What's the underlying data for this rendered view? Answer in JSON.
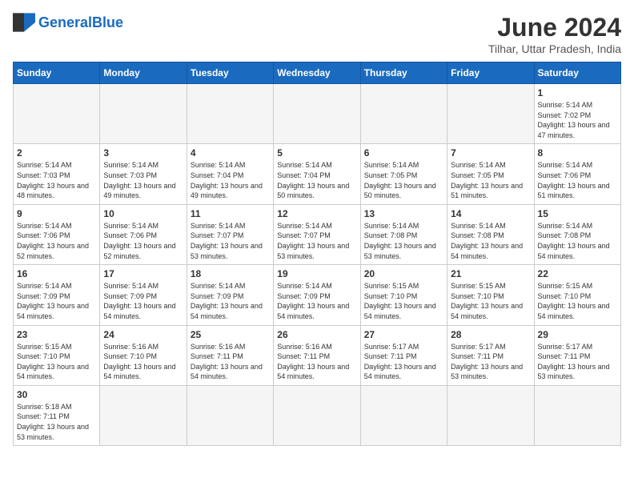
{
  "header": {
    "logo_general": "General",
    "logo_blue": "Blue",
    "month_title": "June 2024",
    "subtitle": "Tilhar, Uttar Pradesh, India"
  },
  "weekdays": [
    "Sunday",
    "Monday",
    "Tuesday",
    "Wednesday",
    "Thursday",
    "Friday",
    "Saturday"
  ],
  "days": [
    {
      "num": "",
      "info": ""
    },
    {
      "num": "",
      "info": ""
    },
    {
      "num": "",
      "info": ""
    },
    {
      "num": "",
      "info": ""
    },
    {
      "num": "",
      "info": ""
    },
    {
      "num": "",
      "info": ""
    },
    {
      "num": "1",
      "info": "Sunrise: 5:14 AM\nSunset: 7:02 PM\nDaylight: 13 hours and 47 minutes."
    },
    {
      "num": "2",
      "info": "Sunrise: 5:14 AM\nSunset: 7:03 PM\nDaylight: 13 hours and 48 minutes."
    },
    {
      "num": "3",
      "info": "Sunrise: 5:14 AM\nSunset: 7:03 PM\nDaylight: 13 hours and 49 minutes."
    },
    {
      "num": "4",
      "info": "Sunrise: 5:14 AM\nSunset: 7:04 PM\nDaylight: 13 hours and 49 minutes."
    },
    {
      "num": "5",
      "info": "Sunrise: 5:14 AM\nSunset: 7:04 PM\nDaylight: 13 hours and 50 minutes."
    },
    {
      "num": "6",
      "info": "Sunrise: 5:14 AM\nSunset: 7:05 PM\nDaylight: 13 hours and 50 minutes."
    },
    {
      "num": "7",
      "info": "Sunrise: 5:14 AM\nSunset: 7:05 PM\nDaylight: 13 hours and 51 minutes."
    },
    {
      "num": "8",
      "info": "Sunrise: 5:14 AM\nSunset: 7:06 PM\nDaylight: 13 hours and 51 minutes."
    },
    {
      "num": "9",
      "info": "Sunrise: 5:14 AM\nSunset: 7:06 PM\nDaylight: 13 hours and 52 minutes."
    },
    {
      "num": "10",
      "info": "Sunrise: 5:14 AM\nSunset: 7:06 PM\nDaylight: 13 hours and 52 minutes."
    },
    {
      "num": "11",
      "info": "Sunrise: 5:14 AM\nSunset: 7:07 PM\nDaylight: 13 hours and 53 minutes."
    },
    {
      "num": "12",
      "info": "Sunrise: 5:14 AM\nSunset: 7:07 PM\nDaylight: 13 hours and 53 minutes."
    },
    {
      "num": "13",
      "info": "Sunrise: 5:14 AM\nSunset: 7:08 PM\nDaylight: 13 hours and 53 minutes."
    },
    {
      "num": "14",
      "info": "Sunrise: 5:14 AM\nSunset: 7:08 PM\nDaylight: 13 hours and 54 minutes."
    },
    {
      "num": "15",
      "info": "Sunrise: 5:14 AM\nSunset: 7:08 PM\nDaylight: 13 hours and 54 minutes."
    },
    {
      "num": "16",
      "info": "Sunrise: 5:14 AM\nSunset: 7:09 PM\nDaylight: 13 hours and 54 minutes."
    },
    {
      "num": "17",
      "info": "Sunrise: 5:14 AM\nSunset: 7:09 PM\nDaylight: 13 hours and 54 minutes."
    },
    {
      "num": "18",
      "info": "Sunrise: 5:14 AM\nSunset: 7:09 PM\nDaylight: 13 hours and 54 minutes."
    },
    {
      "num": "19",
      "info": "Sunrise: 5:14 AM\nSunset: 7:09 PM\nDaylight: 13 hours and 54 minutes."
    },
    {
      "num": "20",
      "info": "Sunrise: 5:15 AM\nSunset: 7:10 PM\nDaylight: 13 hours and 54 minutes."
    },
    {
      "num": "21",
      "info": "Sunrise: 5:15 AM\nSunset: 7:10 PM\nDaylight: 13 hours and 54 minutes."
    },
    {
      "num": "22",
      "info": "Sunrise: 5:15 AM\nSunset: 7:10 PM\nDaylight: 13 hours and 54 minutes."
    },
    {
      "num": "23",
      "info": "Sunrise: 5:15 AM\nSunset: 7:10 PM\nDaylight: 13 hours and 54 minutes."
    },
    {
      "num": "24",
      "info": "Sunrise: 5:16 AM\nSunset: 7:10 PM\nDaylight: 13 hours and 54 minutes."
    },
    {
      "num": "25",
      "info": "Sunrise: 5:16 AM\nSunset: 7:11 PM\nDaylight: 13 hours and 54 minutes."
    },
    {
      "num": "26",
      "info": "Sunrise: 5:16 AM\nSunset: 7:11 PM\nDaylight: 13 hours and 54 minutes."
    },
    {
      "num": "27",
      "info": "Sunrise: 5:17 AM\nSunset: 7:11 PM\nDaylight: 13 hours and 54 minutes."
    },
    {
      "num": "28",
      "info": "Sunrise: 5:17 AM\nSunset: 7:11 PM\nDaylight: 13 hours and 53 minutes."
    },
    {
      "num": "29",
      "info": "Sunrise: 5:17 AM\nSunset: 7:11 PM\nDaylight: 13 hours and 53 minutes."
    },
    {
      "num": "30",
      "info": "Sunrise: 5:18 AM\nSunset: 7:11 PM\nDaylight: 13 hours and 53 minutes."
    },
    {
      "num": "",
      "info": ""
    },
    {
      "num": "",
      "info": ""
    },
    {
      "num": "",
      "info": ""
    },
    {
      "num": "",
      "info": ""
    },
    {
      "num": "",
      "info": ""
    },
    {
      "num": "",
      "info": ""
    }
  ]
}
